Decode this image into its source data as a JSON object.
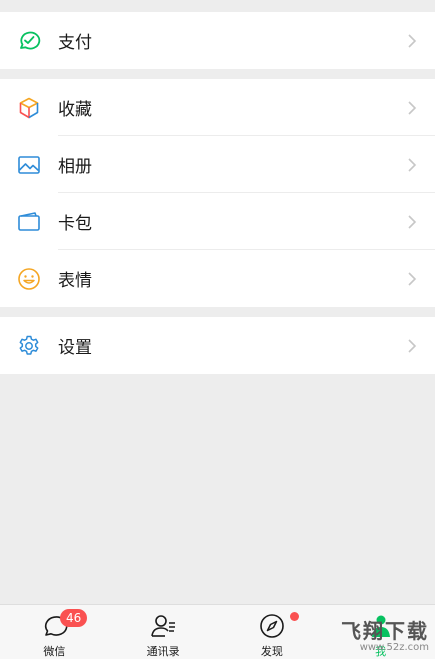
{
  "groups": [
    {
      "items": [
        {
          "label": "支付",
          "icon": "wechat-pay-icon",
          "color": "#07c160"
        }
      ]
    },
    {
      "items": [
        {
          "label": "收藏",
          "icon": "favorites-cube-icon",
          "color": "#f5a623"
        },
        {
          "label": "相册",
          "icon": "album-icon",
          "color": "#2e8cd8"
        },
        {
          "label": "卡包",
          "icon": "card-wallet-icon",
          "color": "#2e8cd8"
        },
        {
          "label": "表情",
          "icon": "emoji-smile-icon",
          "color": "#f5a623"
        }
      ]
    },
    {
      "items": [
        {
          "label": "设置",
          "icon": "settings-gear-icon",
          "color": "#2e8cd8"
        }
      ]
    }
  ],
  "tabbar": {
    "tabs": [
      {
        "label": "微信",
        "icon": "chat-bubble-icon",
        "badge": "46"
      },
      {
        "label": "通讯录",
        "icon": "contacts-icon"
      },
      {
        "label": "发现",
        "icon": "compass-icon",
        "dot": true
      },
      {
        "label": "我",
        "icon": "me-person-icon",
        "active": true
      }
    ]
  },
  "watermark": {
    "text": "飞翔下载",
    "sub": "www.52z.com"
  }
}
